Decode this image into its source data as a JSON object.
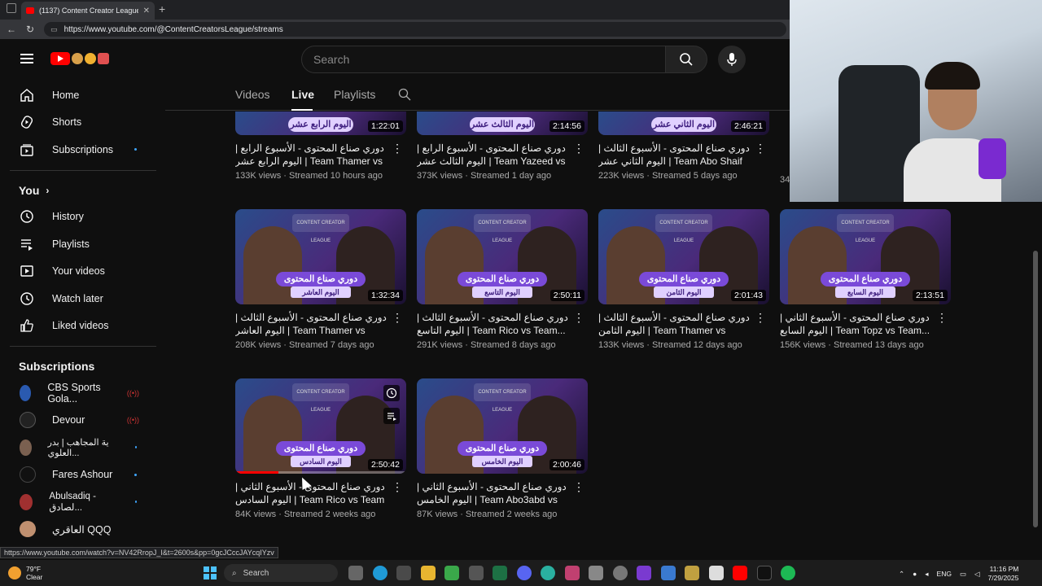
{
  "browser": {
    "tab_title": "(1137) Content Creator League - ",
    "url": "https://www.youtube.com/@ContentCreatorsLeague/streams",
    "status_url": "https://www.youtube.com/watch?v=NV42RropJ_I&t=2600s&pp=0gcJCccJAYcqIYzv"
  },
  "header": {
    "search_placeholder": "Search"
  },
  "sidebar": {
    "main": [
      {
        "label": "Home",
        "icon": "home-icon"
      },
      {
        "label": "Shorts",
        "icon": "shorts-icon"
      },
      {
        "label": "Subscriptions",
        "icon": "subscriptions-icon"
      }
    ],
    "you_heading": "You",
    "you": [
      {
        "label": "History",
        "icon": "history-icon"
      },
      {
        "label": "Playlists",
        "icon": "playlists-icon"
      },
      {
        "label": "Your videos",
        "icon": "your-videos-icon"
      },
      {
        "label": "Watch later",
        "icon": "watch-later-icon"
      },
      {
        "label": "Liked videos",
        "icon": "liked-icon"
      }
    ],
    "subs_heading": "Subscriptions",
    "subscriptions": [
      {
        "label": "CBS Sports Gola...",
        "indicator": "live"
      },
      {
        "label": "Devour",
        "indicator": "live"
      },
      {
        "label": "ية المجاهب | بدر العلوي...",
        "indicator": "dot"
      },
      {
        "label": "Fares Ashour",
        "indicator": "dot"
      },
      {
        "label": "Abulsadiq - لصادق...",
        "indicator": "dot"
      },
      {
        "label": "العاقري QQQ",
        "indicator": "none"
      }
    ]
  },
  "channel_tabs": [
    "Videos",
    "Live",
    "Playlists"
  ],
  "videos_row1": [
    {
      "banner": "دوري صناع المحتوى",
      "sub": "اليوم الرابع عشر",
      "duration": "1:22:01",
      "title": "دوري صناع المحتوى - الأسبوع الرابع | اليوم الرابع عشر | Team Thamer vs Team...",
      "stats": "133K views · Streamed 10 hours ago"
    },
    {
      "banner": "دوري صناع المحتوى",
      "sub": "اليوم الثالث عشر",
      "duration": "2:14:56",
      "title": "دوري صناع المحتوى - الأسبوع الرابع | اليوم الثالث عشر | Team Yazeed vs Team...",
      "stats": "373K views · Streamed 1 day ago"
    },
    {
      "banner": "دوري صناع المحتوى",
      "sub": "اليوم الثاني عشر",
      "duration": "2:46:21",
      "title": "دوري صناع المحتوى - الأسبوع الثالث | اليوم الثاني عشر | Team Abo Shaif vs Team...",
      "stats": "223K views · Streamed 5 days ago"
    }
  ],
  "videos_row2": [
    {
      "banner": "دوري صناع المحتوى",
      "sub": "اليوم العاشر",
      "duration": "1:32:34",
      "title": "دوري صناع المحتوى - الأسبوع الثالث | اليوم العاشر | Team Thamer vs Team...",
      "stats": "208K views · Streamed 7 days ago"
    },
    {
      "banner": "دوري صناع المحتوى",
      "sub": "اليوم التاسع",
      "duration": "2:50:11",
      "title": "دوري صناع المحتوى - الأسبوع الثالث | اليوم التاسع | Team Rico vs Team...",
      "stats": "291K views · Streamed 8 days ago"
    },
    {
      "banner": "دوري صناع المحتوى",
      "sub": "اليوم الثامن",
      "duration": "2:01:43",
      "title": "دوري صناع المحتوى - الأسبوع الثالث | اليوم الثامن | Team Thamer vs Team Abo...",
      "stats": "133K views · Streamed 12 days ago"
    },
    {
      "banner": "دوري صناع المحتوى",
      "sub": "اليوم السابع",
      "duration": "2:13:51",
      "title": "دوري صناع المحتوى - الأسبوع الثاني | اليوم السابع | Team Topz vs Team...",
      "stats": "156K views · Streamed 13 days ago"
    }
  ],
  "videos_row3": [
    {
      "banner": "دوري صناع المحتوى",
      "sub": "اليوم السادس",
      "duration": "2:50:42",
      "title": "دوري صناع المحتوى - الأسبوع الثاني | اليوم السادس | Team Rico vs Team Abu...",
      "stats": "84K views · Streamed 2 weeks ago",
      "progress": 0.25
    },
    {
      "banner": "دوري صناع المحتوى",
      "sub": "اليوم الخامس",
      "duration": "2:00:46",
      "title": "دوري صناع المحتوى - الأسبوع الثاني | اليوم الخامس | Team Abo3abd vs Team...",
      "stats": "87K views · Streamed 2 weeks ago"
    }
  ],
  "thumb_logo_text": "CONTENT CREATOR LEAGUE",
  "partial_stat": "34",
  "taskbar": {
    "temp": "79°F",
    "condition": "Clear",
    "search": "Search",
    "lang": "ENG",
    "time": "11:16 PM",
    "date": "7/29/2025"
  },
  "colors": {
    "accent": "#ff0000",
    "bg": "#0f0f0f",
    "thumb_banner": "#7a4ad8"
  }
}
